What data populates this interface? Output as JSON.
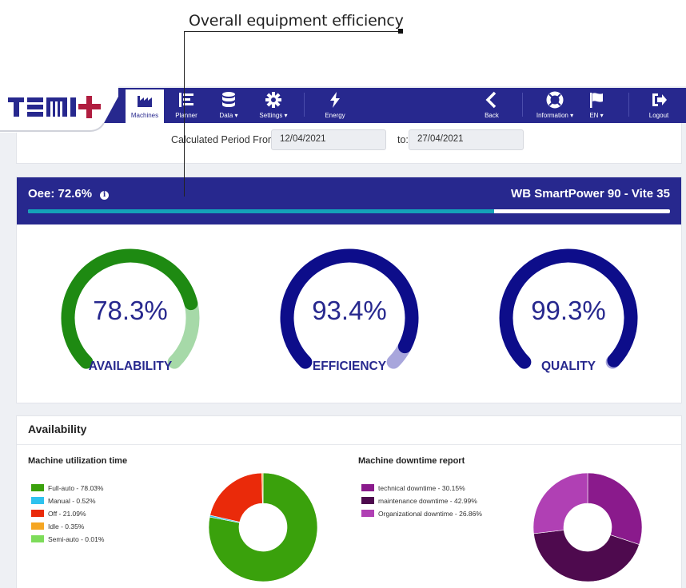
{
  "annotation": {
    "title": "Overall equipment efficiency"
  },
  "brand": {
    "logo_text": "TEMI+"
  },
  "nav": {
    "items": [
      {
        "label": "Machines",
        "icon": "factory-icon",
        "active": true
      },
      {
        "label": "Planner",
        "icon": "list-icon"
      },
      {
        "label": "Data ▾",
        "icon": "database-icon"
      },
      {
        "label": "Settings ▾",
        "icon": "gear-icon"
      },
      {
        "label": "Energy",
        "icon": "bolt-icon"
      },
      {
        "label": "Back",
        "icon": "chevron-left-icon"
      },
      {
        "label": "Information ▾",
        "icon": "lifebuoy-icon"
      },
      {
        "label": "EN ▾",
        "icon": "flag-icon"
      },
      {
        "label": "Logout",
        "icon": "logout-icon"
      }
    ]
  },
  "period": {
    "from_label": "Calculated Period From:",
    "from_value": "12/04/2021",
    "to_label": "to:",
    "to_value": "27/04/2021"
  },
  "oee": {
    "label": "Oee: 72.6%",
    "info_icon": "info-icon",
    "value": 0.726,
    "machine": "WB SmartPower 90 - Vite 35",
    "colors": {
      "header": "#27288e",
      "bar": "#14a2b8"
    }
  },
  "gauges": [
    {
      "value_text": "78.3%",
      "value": 0.783,
      "label": "AVAILABILITY",
      "color": "#1e8a12",
      "track": "#a6d9a8"
    },
    {
      "value_text": "93.4%",
      "value": 0.934,
      "label": "EFFICIENCY",
      "color": "#0d0d8a",
      "track": "#a8a6dc"
    },
    {
      "value_text": "99.3%",
      "value": 0.993,
      "label": "QUALITY",
      "color": "#0d0d8a",
      "track": "#a8a6dc"
    }
  ],
  "availability": {
    "title": "Availability",
    "utilization": {
      "title": "Machine utilization time",
      "items": [
        {
          "label": "Full-auto - 78.03%",
          "value": 78.03,
          "color": "#3aa10c"
        },
        {
          "label": "Manual - 0.52%",
          "value": 0.52,
          "color": "#2fc2ee"
        },
        {
          "label": "Off - 21.09%",
          "value": 21.09,
          "color": "#ea2a0a"
        },
        {
          "label": "Idle - 0.35%",
          "value": 0.35,
          "color": "#f5a623"
        },
        {
          "label": "Semi-auto - 0.01%",
          "value": 0.01,
          "color": "#7ddc5a"
        }
      ]
    },
    "downtime": {
      "title": "Machine downtime report",
      "items": [
        {
          "label": "technical downtime - 30.15%",
          "value": 30.15,
          "color": "#8a1a8c"
        },
        {
          "label": "maintenance downtime - 42.99%",
          "value": 42.99,
          "color": "#4e0a4e"
        },
        {
          "label": "Organizational downtime - 26.86%",
          "value": 26.86,
          "color": "#b040b4"
        }
      ]
    }
  }
}
